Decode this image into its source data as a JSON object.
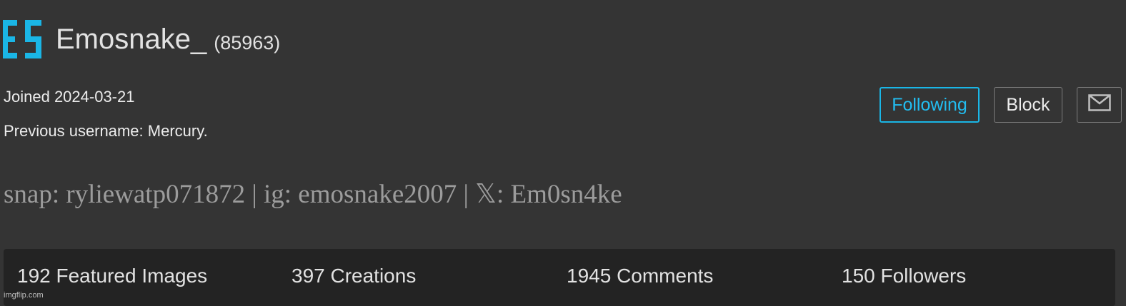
{
  "profile": {
    "logo_icon": "es-letter-logo",
    "username": "Emosnake_",
    "user_id": "(85963)",
    "joined": "Joined 2024-03-21",
    "previous_username": "Previous username: Mercury.",
    "bio": "snap: ryliewatp071872 | ig: emosnake2007 | 𝕏: Em0sn4ke"
  },
  "actions": {
    "following_label": "Following",
    "block_label": "Block",
    "message_icon": "envelope-icon"
  },
  "stats": {
    "featured": "192 Featured Images",
    "creations": "397 Creations",
    "comments": "1945 Comments",
    "followers": "150 Followers"
  },
  "watermark": "imgflip.com",
  "colors": {
    "background": "#343434",
    "accent": "#1ab6e6",
    "stats_bar": "#232323",
    "bio_text": "#9c9c9c"
  }
}
